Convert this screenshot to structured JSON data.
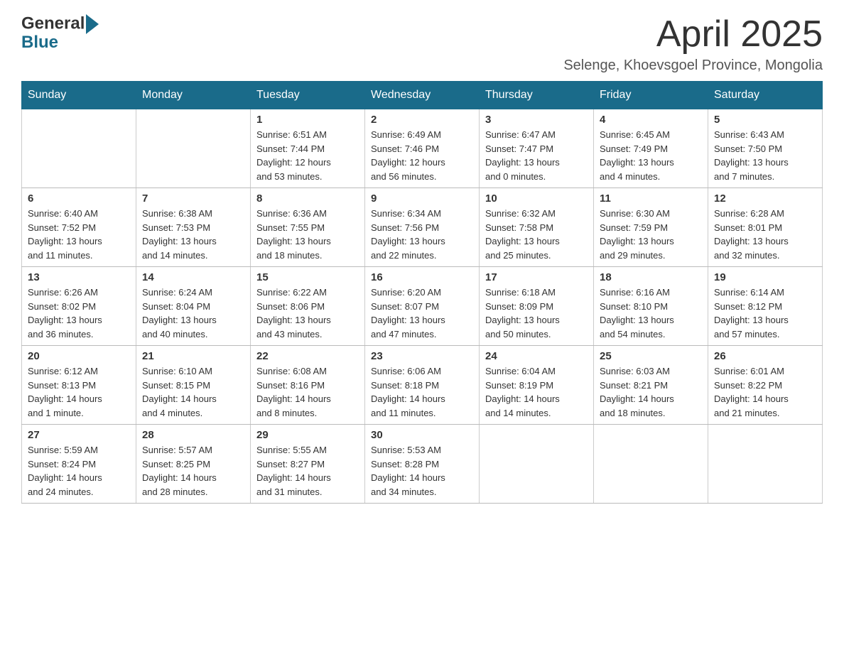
{
  "header": {
    "logo_general": "General",
    "logo_blue": "Blue",
    "title": "April 2025",
    "location": "Selenge, Khoevsgoel Province, Mongolia"
  },
  "days_of_week": [
    "Sunday",
    "Monday",
    "Tuesday",
    "Wednesday",
    "Thursday",
    "Friday",
    "Saturday"
  ],
  "weeks": [
    [
      {
        "day": "",
        "info": ""
      },
      {
        "day": "",
        "info": ""
      },
      {
        "day": "1",
        "info": "Sunrise: 6:51 AM\nSunset: 7:44 PM\nDaylight: 12 hours\nand 53 minutes."
      },
      {
        "day": "2",
        "info": "Sunrise: 6:49 AM\nSunset: 7:46 PM\nDaylight: 12 hours\nand 56 minutes."
      },
      {
        "day": "3",
        "info": "Sunrise: 6:47 AM\nSunset: 7:47 PM\nDaylight: 13 hours\nand 0 minutes."
      },
      {
        "day": "4",
        "info": "Sunrise: 6:45 AM\nSunset: 7:49 PM\nDaylight: 13 hours\nand 4 minutes."
      },
      {
        "day": "5",
        "info": "Sunrise: 6:43 AM\nSunset: 7:50 PM\nDaylight: 13 hours\nand 7 minutes."
      }
    ],
    [
      {
        "day": "6",
        "info": "Sunrise: 6:40 AM\nSunset: 7:52 PM\nDaylight: 13 hours\nand 11 minutes."
      },
      {
        "day": "7",
        "info": "Sunrise: 6:38 AM\nSunset: 7:53 PM\nDaylight: 13 hours\nand 14 minutes."
      },
      {
        "day": "8",
        "info": "Sunrise: 6:36 AM\nSunset: 7:55 PM\nDaylight: 13 hours\nand 18 minutes."
      },
      {
        "day": "9",
        "info": "Sunrise: 6:34 AM\nSunset: 7:56 PM\nDaylight: 13 hours\nand 22 minutes."
      },
      {
        "day": "10",
        "info": "Sunrise: 6:32 AM\nSunset: 7:58 PM\nDaylight: 13 hours\nand 25 minutes."
      },
      {
        "day": "11",
        "info": "Sunrise: 6:30 AM\nSunset: 7:59 PM\nDaylight: 13 hours\nand 29 minutes."
      },
      {
        "day": "12",
        "info": "Sunrise: 6:28 AM\nSunset: 8:01 PM\nDaylight: 13 hours\nand 32 minutes."
      }
    ],
    [
      {
        "day": "13",
        "info": "Sunrise: 6:26 AM\nSunset: 8:02 PM\nDaylight: 13 hours\nand 36 minutes."
      },
      {
        "day": "14",
        "info": "Sunrise: 6:24 AM\nSunset: 8:04 PM\nDaylight: 13 hours\nand 40 minutes."
      },
      {
        "day": "15",
        "info": "Sunrise: 6:22 AM\nSunset: 8:06 PM\nDaylight: 13 hours\nand 43 minutes."
      },
      {
        "day": "16",
        "info": "Sunrise: 6:20 AM\nSunset: 8:07 PM\nDaylight: 13 hours\nand 47 minutes."
      },
      {
        "day": "17",
        "info": "Sunrise: 6:18 AM\nSunset: 8:09 PM\nDaylight: 13 hours\nand 50 minutes."
      },
      {
        "day": "18",
        "info": "Sunrise: 6:16 AM\nSunset: 8:10 PM\nDaylight: 13 hours\nand 54 minutes."
      },
      {
        "day": "19",
        "info": "Sunrise: 6:14 AM\nSunset: 8:12 PM\nDaylight: 13 hours\nand 57 minutes."
      }
    ],
    [
      {
        "day": "20",
        "info": "Sunrise: 6:12 AM\nSunset: 8:13 PM\nDaylight: 14 hours\nand 1 minute."
      },
      {
        "day": "21",
        "info": "Sunrise: 6:10 AM\nSunset: 8:15 PM\nDaylight: 14 hours\nand 4 minutes."
      },
      {
        "day": "22",
        "info": "Sunrise: 6:08 AM\nSunset: 8:16 PM\nDaylight: 14 hours\nand 8 minutes."
      },
      {
        "day": "23",
        "info": "Sunrise: 6:06 AM\nSunset: 8:18 PM\nDaylight: 14 hours\nand 11 minutes."
      },
      {
        "day": "24",
        "info": "Sunrise: 6:04 AM\nSunset: 8:19 PM\nDaylight: 14 hours\nand 14 minutes."
      },
      {
        "day": "25",
        "info": "Sunrise: 6:03 AM\nSunset: 8:21 PM\nDaylight: 14 hours\nand 18 minutes."
      },
      {
        "day": "26",
        "info": "Sunrise: 6:01 AM\nSunset: 8:22 PM\nDaylight: 14 hours\nand 21 minutes."
      }
    ],
    [
      {
        "day": "27",
        "info": "Sunrise: 5:59 AM\nSunset: 8:24 PM\nDaylight: 14 hours\nand 24 minutes."
      },
      {
        "day": "28",
        "info": "Sunrise: 5:57 AM\nSunset: 8:25 PM\nDaylight: 14 hours\nand 28 minutes."
      },
      {
        "day": "29",
        "info": "Sunrise: 5:55 AM\nSunset: 8:27 PM\nDaylight: 14 hours\nand 31 minutes."
      },
      {
        "day": "30",
        "info": "Sunrise: 5:53 AM\nSunset: 8:28 PM\nDaylight: 14 hours\nand 34 minutes."
      },
      {
        "day": "",
        "info": ""
      },
      {
        "day": "",
        "info": ""
      },
      {
        "day": "",
        "info": ""
      }
    ]
  ]
}
